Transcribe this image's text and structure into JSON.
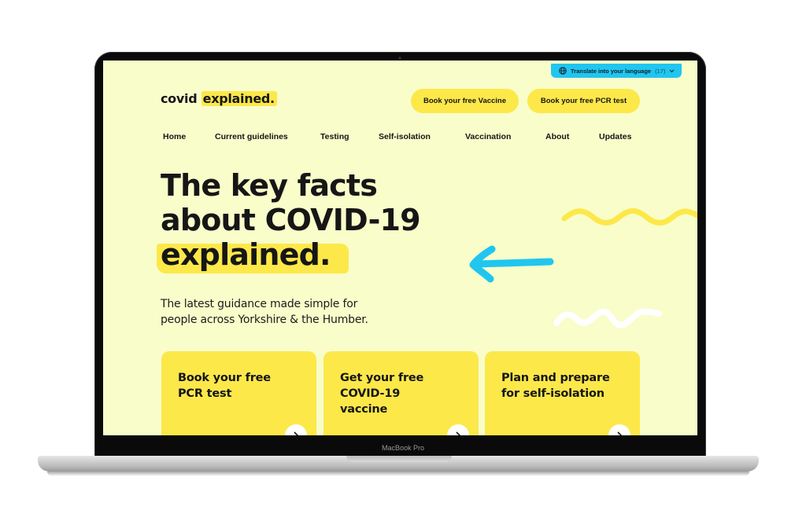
{
  "device": {
    "label": "MacBook Pro"
  },
  "translate": {
    "icon": "globe-icon",
    "label": "Translate into your language",
    "count": "(17)",
    "chevron": "chevron-down-icon"
  },
  "header": {
    "logo_plain": "covid",
    "logo_highlight": "explained.",
    "buttons": [
      {
        "label": "Book your free Vaccine"
      },
      {
        "label": "Book your free PCR test"
      }
    ]
  },
  "nav": {
    "items": [
      {
        "label": "Home"
      },
      {
        "label": "Current guidelines"
      },
      {
        "label": "Testing"
      },
      {
        "label": "Self-isolation"
      },
      {
        "label": "Vaccination"
      },
      {
        "label": "About"
      },
      {
        "label": "Updates"
      }
    ]
  },
  "hero": {
    "title_line1": "The key facts",
    "title_line2": "about COVID-19",
    "title_highlight": "explained.",
    "subtitle_line1": "The latest guidance made simple for",
    "subtitle_line2": "people across Yorkshire & the Humber."
  },
  "cards": [
    {
      "title_line1": "Book your free",
      "title_line2": "PCR test",
      "title_line3": ""
    },
    {
      "title_line1": "Get your free",
      "title_line2": "COVID-19",
      "title_line3": "vaccine"
    },
    {
      "title_line1": "Plan and prepare",
      "title_line2": "for self-isolation",
      "title_line3": ""
    }
  ],
  "colors": {
    "background": "#f8fdca",
    "accent_yellow": "#fde84a",
    "accent_blue": "#20c6f0",
    "text": "#161616"
  }
}
